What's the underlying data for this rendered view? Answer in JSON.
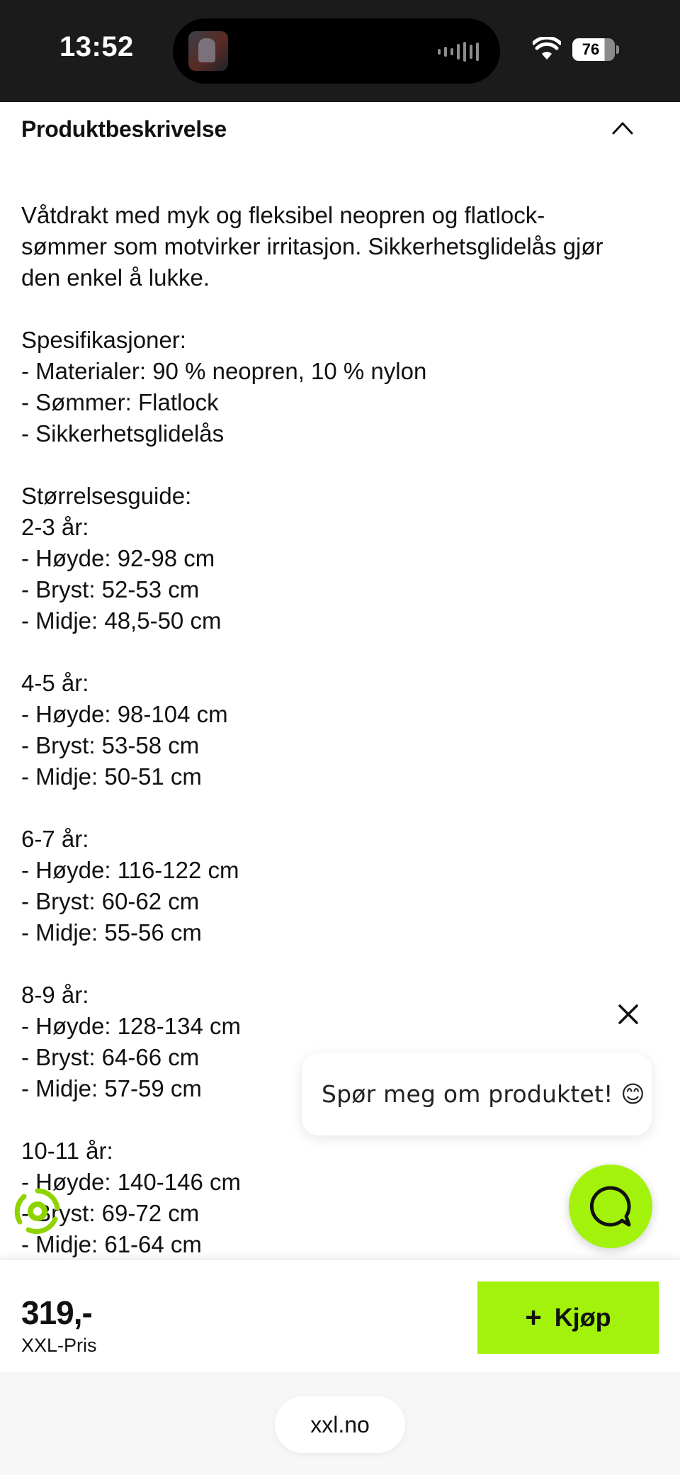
{
  "status_bar": {
    "time": "13:52",
    "battery": "76",
    "icons": [
      "now-playing-artwork-icon",
      "audio-waveform-icon",
      "wifi-icon",
      "battery-icon"
    ]
  },
  "section": {
    "title": "Produktbeskrivelse",
    "toggle_icon": "chevron-up-icon"
  },
  "description": {
    "blocks": [
      [
        "Våtdrakt med myk og fleksibel neopren og flatlock-",
        "sømmer som motvirker irritasjon. Sikkerhetsglidelås gjør",
        "den enkel å lukke."
      ],
      [
        "Spesifikasjoner:",
        "- Materialer: 90 % neopren, 10 % nylon",
        "- Sømmer: Flatlock",
        "- Sikkerhetsglidelås"
      ],
      [
        "Størrelsesguide:",
        "2-3 år:",
        "- Høyde: 92-98 cm",
        "- Bryst: 52-53 cm",
        "- Midje: 48,5-50 cm"
      ],
      [
        "4-5 år:",
        "- Høyde: 98-104 cm",
        "- Bryst: 53-58 cm",
        "- Midje: 50-51 cm"
      ],
      [
        "6-7 år:",
        "- Høyde: 116-122 cm",
        "- Bryst: 60-62 cm",
        "- Midje: 55-56 cm"
      ],
      [
        "8-9 år:",
        "- Høyde: 128-134 cm",
        "- Bryst: 64-66 cm",
        "- Midje: 57-59 cm"
      ],
      [
        "10-11 år:",
        "- Høyde: 140-146 cm",
        "- Bryst: 69-72 cm",
        "- Midje: 61-64 cm"
      ]
    ]
  },
  "chat": {
    "prompt": "Spør meg om produktet! 😊",
    "close_icon": "close-icon",
    "launcher_icon": "chat-icon",
    "accent": "#a3f20c"
  },
  "recycle_badge_icon": "recycle-icon",
  "buy_bar": {
    "price": "319,-",
    "price_label": "XXL-Pris",
    "buy_label": "Kjøp",
    "buy_icon": "plus-icon",
    "accent": "#a3f20c"
  },
  "browser": {
    "url": "xxl.no"
  }
}
